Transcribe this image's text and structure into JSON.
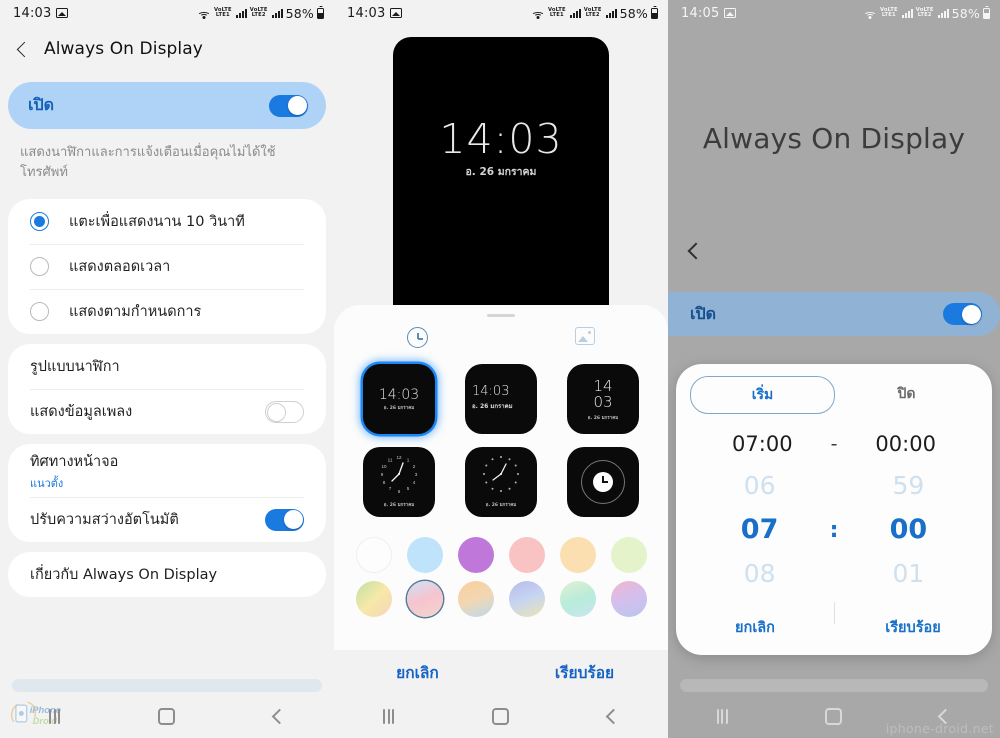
{
  "statusbar": {
    "time_left": "14:03",
    "time_right": "14:05",
    "battery": "58%",
    "lte1": "LTE1",
    "lte2": "LTE2",
    "vo1": "VoLTE",
    "vo2": "VoLTE"
  },
  "panel1": {
    "title": "Always On Display",
    "back_icon": "chevron-left-icon",
    "master_toggle": {
      "label": "เปิด",
      "state": "on"
    },
    "description": "แสดงนาฬิกาและการแจ้งเตือนเมื่อคุณไม่ได้ใช้โทรศัพท์",
    "radio_options": [
      {
        "label": "แตะเพื่อแสดงนาน 10 วินาที",
        "selected": true
      },
      {
        "label": "แสดงตลอดเวลา",
        "selected": false
      },
      {
        "label": "แสดงตามกำหนดการ",
        "selected": false
      }
    ],
    "rows_group2": [
      {
        "title": "รูปแบบนาฬิกา",
        "sub": "",
        "toggle": null
      },
      {
        "title": "แสดงข้อมูลเพลง",
        "sub": "",
        "toggle": "off"
      }
    ],
    "rows_group3": [
      {
        "title": "ทิศทางหน้าจอ",
        "sub": "แนวตั้ง",
        "toggle": null
      },
      {
        "title": "ปรับความสว่างอัตโนมัติ",
        "sub": "",
        "toggle": "on"
      }
    ],
    "rows_group4": [
      {
        "title": "เกี่ยวกับ Always On Display",
        "sub": "",
        "toggle": null
      }
    ],
    "watermark": "iPhoneDroid"
  },
  "panel2": {
    "preview": {
      "clock": "14:03",
      "date": "อ. 26 มกราคม"
    },
    "tabs": [
      {
        "icon": "clock-icon",
        "active": true
      },
      {
        "icon": "image-icon",
        "active": false
      }
    ],
    "clock_styles": [
      {
        "type": "digital-center",
        "time": "14:03",
        "date": "อ. 26 มกราคม",
        "selected": true
      },
      {
        "type": "digital-left",
        "time": "14:03",
        "date": "อ. 26 มกราคม",
        "selected": false
      },
      {
        "type": "digital-stacked",
        "time_h": "14",
        "time_m": "03",
        "date": "อ. 26 มกราคม",
        "selected": false
      },
      {
        "type": "analog-numbers",
        "date": "อ. 26 มกราคม",
        "selected": false
      },
      {
        "type": "analog-dots",
        "date": "อ. 26 มกราคม",
        "selected": false
      },
      {
        "type": "ring",
        "selected": false
      }
    ],
    "colors": [
      {
        "name": "white",
        "hex": "#fdfdfd",
        "selected": false
      },
      {
        "name": "light-blue",
        "hex": "#bfe3fa",
        "selected": false
      },
      {
        "name": "purple",
        "hex": "#c077da",
        "selected": false
      },
      {
        "name": "pink",
        "hex": "#f8c3c2",
        "selected": false
      },
      {
        "name": "peach",
        "hex": "#fbdfb1",
        "selected": false
      },
      {
        "name": "light-green",
        "hex": "#e4f3c9",
        "selected": false
      },
      {
        "name": "green-yellow-gradient",
        "hex": "#cfe6a8",
        "selected": false
      },
      {
        "name": "pink-blue-gradient",
        "hex": "#f6c9d6",
        "selected": true
      },
      {
        "name": "orange-blue-gradient",
        "hex": "#f7cd9e",
        "selected": false
      },
      {
        "name": "purple-yellow-gradient",
        "hex": "#b9c3ef",
        "selected": false
      },
      {
        "name": "teal-gradient",
        "hex": "#c4eede",
        "selected": false
      },
      {
        "name": "pink-purple-gradient",
        "hex": "#e5b7dd",
        "selected": false
      }
    ],
    "cancel_label": "ยกเลิก",
    "done_label": "เรียบร้อย"
  },
  "panel3": {
    "page_title": "Always On Display",
    "back_icon": "chevron-left-icon",
    "master_toggle": {
      "label": "เปิด",
      "state": "on"
    },
    "dialog": {
      "segments": [
        {
          "label": "เริ่ม",
          "active": true
        },
        {
          "label": "ปิด",
          "active": false
        }
      ],
      "range_start": "07:00",
      "range_dash": "-",
      "range_end": "00:00",
      "hour": {
        "prev": "06",
        "current": "07",
        "next": "08"
      },
      "separator": ":",
      "minute": {
        "prev": "59",
        "current": "00",
        "next": "01"
      },
      "cancel_label": "ยกเลิก",
      "done_label": "เรียบร้อย"
    },
    "watermark": "iphone-droid.net"
  },
  "navbar": {
    "recent_icon": "recents-icon",
    "home_icon": "home-icon",
    "back_icon": "back-icon"
  }
}
